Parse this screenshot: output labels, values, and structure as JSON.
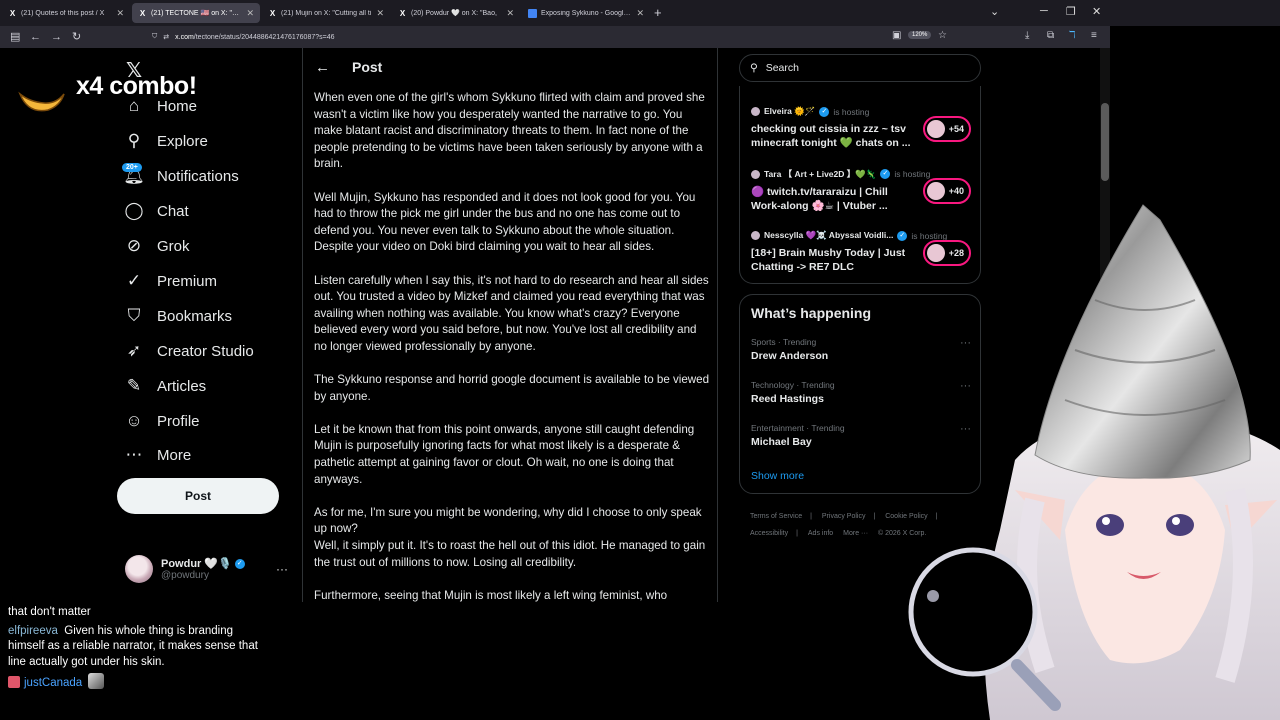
{
  "browser": {
    "tabs": [
      {
        "icon": "X",
        "title": "(21) Quotes of this post / X",
        "active": false
      },
      {
        "icon": "X",
        "title": "(21) TECTONE 🇺🇸 on X: \"Cutting",
        "active": true
      },
      {
        "icon": "X",
        "title": "(21) Mujin on X: \"Cutting all ti",
        "active": false
      },
      {
        "icon": "X",
        "title": "(20) Powdur 🤍 on X: \"Bao,",
        "active": false
      },
      {
        "icon": "doc",
        "title": "Exposing Sykkuno - Google Do",
        "active": false
      }
    ],
    "url_host": "x.com",
    "url_path": "/tectone/status/2044886421476176087?s=46",
    "zoom": "120%"
  },
  "nav": {
    "items": [
      {
        "label": "Home",
        "icon": "home-icon"
      },
      {
        "label": "Explore",
        "icon": "search-icon"
      },
      {
        "label": "Notifications",
        "icon": "bell-icon"
      },
      {
        "label": "Chat",
        "icon": "chat-icon"
      },
      {
        "label": "Grok",
        "icon": "grok-icon"
      },
      {
        "label": "Premium",
        "icon": "premium-icon"
      },
      {
        "label": "Bookmarks",
        "icon": "bookmark-icon"
      },
      {
        "label": "Creator Studio",
        "icon": "rocket-icon"
      },
      {
        "label": "Articles",
        "icon": "article-icon"
      },
      {
        "label": "Profile",
        "icon": "person-icon"
      },
      {
        "label": "More",
        "icon": "more-circle-icon"
      }
    ],
    "notifications_badge": "20+",
    "post_button": "Post",
    "account": {
      "name": "Powdur 🤍🎙️",
      "handle": "@powdury"
    }
  },
  "post": {
    "header": "Post",
    "paragraphs": [
      "When even one of the girl's whom Sykkuno flirted with claim and proved she wasn't a victim like how you desperately wanted the narrative to go. You make blatant racist and discriminatory threats to them. In fact none of the people pretending to be victims have been taken seriously by anyone with a brain.",
      "Well Mujin, Sykkuno has responded and it does not look good for you. You had to throw the pick me girl under the bus and no one has come out to defend you. You never even talk to Sykkuno about the whole situation. Despite your video on Doki bird claiming you wait to hear all sides.",
      "Listen carefully when I say this, it's not hard to do research and hear all sides out. You trusted a video by Mizkef and claimed you read everything that was availing when nothing was available. You know what's crazy? Everyone believed every word you said before, but now. You've lost all credibility and no longer viewed professionally by anyone.",
      "The Sykkuno response and horrid google document is available to be viewed by anyone.",
      "Let it be known that from this point onwards, anyone still caught defending Mujin is purposefully ignoring facts for what most likely is a desperate & pathetic attempt at gaining favor or clout. Oh wait, no one is doing that anyways.",
      "As for me, I'm sure you might be wondering, why did I choose to only speak up now?",
      "Well, it simply put it. It's to roast the hell out of this idiot. He managed to gain the trust out of millions to now. Losing all credibility.",
      "Furthermore, seeing that Mujin is most likely a left wing feminist, who"
    ]
  },
  "sidebar": {
    "search_placeholder": "Search",
    "live": [
      {
        "host": "Elveira 🌞🪄",
        "status": "is hosting",
        "title": "checking out cissia in zzz ~ tsv minecraft tonight 💚 chats on ...",
        "count": "+54"
      },
      {
        "host": "Tara 【 Art + Live2D 】💚🦎",
        "status": "is hosting",
        "title": "🟣 twitch.tv/tararaizu | Chill Work-along 🌸☕ | Vtuber ...",
        "count": "+40"
      },
      {
        "host": "Nesscylla 💜☠️ Abyssal Voidli...",
        "status": "is hosting",
        "title": "[18+] Brain Mushy Today | Just Chatting -> RE7 DLC",
        "count": "+28"
      }
    ],
    "happening_title": "What’s happening",
    "trends": [
      {
        "meta": "Sports · Trending",
        "name": "Drew Anderson"
      },
      {
        "meta": "Technology · Trending",
        "name": "Reed Hastings"
      },
      {
        "meta": "Entertainment · Trending",
        "name": "Michael Bay"
      }
    ],
    "show_more": "Show more",
    "footer": [
      "Terms of Service",
      "Privacy Policy",
      "Cookie Policy",
      "Accessibility",
      "Ads info",
      "More ···",
      "© 2026 X Corp."
    ]
  },
  "overlay": {
    "combo_text": "x4 combo!",
    "chat": [
      {
        "user": "",
        "message": "that don't matter"
      },
      {
        "user": "elfpireeva",
        "message": "Given his whole thing is branding himself as a reliable narrator, it makes sense that line actually got under his skin."
      },
      {
        "user": "justCanada",
        "message": ""
      }
    ]
  },
  "colors": {
    "accent": "#1d9bf0",
    "live_ring": "#f91880",
    "border": "#2f3336",
    "muted": "#71767b"
  }
}
